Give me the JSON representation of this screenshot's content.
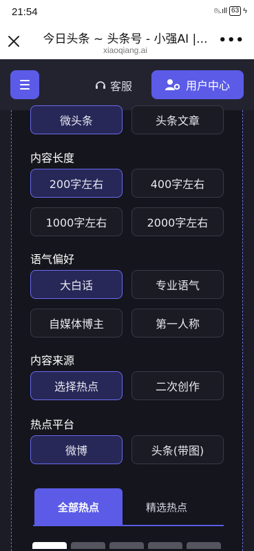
{
  "status_bar": {
    "time": "21:54",
    "signal": "⌾ᵢ.ıll",
    "battery": "63"
  },
  "browser": {
    "title": "今日头条 ~ 头条号 - 小强AI |...",
    "domain": "xiaoqiang.ai",
    "more": "•••"
  },
  "header": {
    "service_label": "客服",
    "user_center_label": "用户中心"
  },
  "sections": [
    {
      "label": "",
      "options": [
        "微头条",
        "头条文章"
      ],
      "selected": 0
    },
    {
      "label": "内容长度",
      "options": [
        "200字左右",
        "400字左右",
        "1000字左右",
        "2000字左右"
      ],
      "selected": 0
    },
    {
      "label": "语气偏好",
      "options": [
        "大白话",
        "专业语气",
        "自媒体博主",
        "第一人称"
      ],
      "selected": 0
    },
    {
      "label": "内容来源",
      "options": [
        "选择热点",
        "二次创作"
      ],
      "selected": 0
    },
    {
      "label": "热点平台",
      "options": [
        "微博",
        "头条(带图)"
      ],
      "selected": 0
    }
  ],
  "tabs": [
    "全部热点",
    "精选热点"
  ],
  "colors": {
    "accent": "#5b5be8",
    "background": "#15151d",
    "header": "#23232f"
  }
}
